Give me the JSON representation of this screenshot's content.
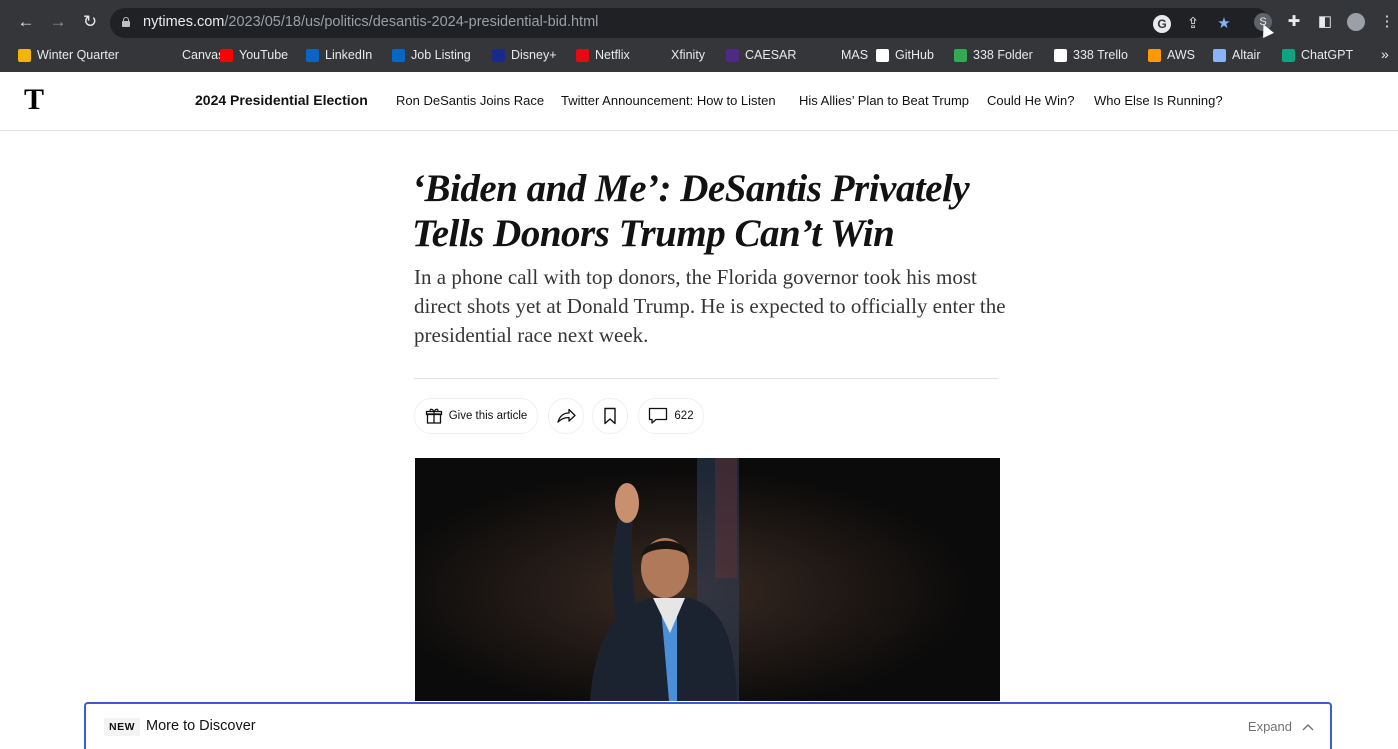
{
  "browser": {
    "url_host": "nytimes.com",
    "url_path": "/2023/05/18/us/politics/desantis-2024-presidential-bid.html",
    "extension_s_label": "S",
    "bookmarks": [
      {
        "label": "Winter Quarter",
        "icon": "google-drive-icon",
        "color": "#f4b400"
      },
      {
        "label": "Canvas",
        "icon": "canvas-icon",
        "color": "#35363a"
      },
      {
        "label": "YouTube",
        "icon": "youtube-icon",
        "color": "#ff0000"
      },
      {
        "label": "LinkedIn",
        "icon": "linkedin-icon",
        "color": "#0a66c2"
      },
      {
        "label": "Job Listing",
        "icon": "linkedin-icon",
        "color": "#0a66c2"
      },
      {
        "label": "Disney+",
        "icon": "disney-plus-icon",
        "color": "#1a2a8c"
      },
      {
        "label": "Netflix",
        "icon": "netflix-icon",
        "color": "#e50914"
      },
      {
        "label": "Xfinity",
        "icon": "xfinity-icon",
        "color": "#35363a"
      },
      {
        "label": "CAESAR",
        "icon": "northwestern-n-icon",
        "color": "#4e2a84"
      },
      {
        "label": "MAS",
        "icon": "mas-icon",
        "color": "#35363a"
      },
      {
        "label": "GitHub",
        "icon": "github-icon",
        "color": "#ffffff"
      },
      {
        "label": "338 Folder",
        "icon": "google-drive-icon",
        "color": "#34a853"
      },
      {
        "label": "338 Trello",
        "icon": "trello-icon",
        "color": "#ffffff"
      },
      {
        "label": "AWS",
        "icon": "aws-icon",
        "color": "#ff9900"
      },
      {
        "label": "Altair",
        "icon": "star-icon",
        "color": "#8ab4f8"
      },
      {
        "label": "ChatGPT",
        "icon": "chatgpt-icon",
        "color": "#10a37f"
      }
    ],
    "more_label": "»"
  },
  "nyt": {
    "logo": "T",
    "nav": [
      "2024 Presidential Election",
      "Ron DeSantis Joins Race",
      "Twitter Announcement: How to Listen",
      "His Allies’ Plan to Beat Trump",
      "Could He Win?",
      "Who Else Is Running?"
    ]
  },
  "article": {
    "headline": "‘Biden and Me’: DeSantis Privately Tells Donors Trump Can’t Win",
    "summary": "In a phone call with top donors, the Florida governor took his most direct shots yet at Donald Trump. He is expected to officially enter the presidential race next week.",
    "give_label": "Give this article",
    "comment_count": "622"
  },
  "banner": {
    "badge": "NEW",
    "title": "More to Discover",
    "expand_label": "Expand"
  }
}
